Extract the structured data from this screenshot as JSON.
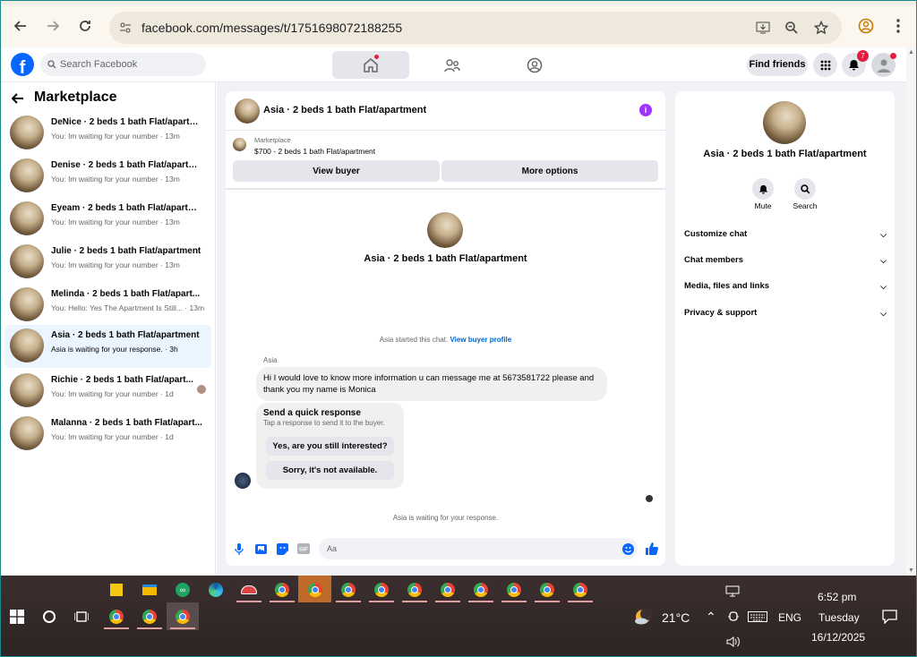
{
  "browser": {
    "url": "facebook.com/messages/t/1751698072188255",
    "icons": [
      "back-icon",
      "forward-icon",
      "reload-icon",
      "site-settings-icon",
      "install-icon",
      "zoom-icon",
      "bookmark-star-icon",
      "profile-icon",
      "menu-icon"
    ]
  },
  "fb": {
    "search_placeholder": "Search Facebook",
    "find_friends": "Find friends",
    "notif_count": "7"
  },
  "sidebar": {
    "title": "Marketplace",
    "conversations": [
      {
        "name": "DeNice · 2 beds 1 bath Flat/apartm...",
        "preview": "You: Im waiting for your number · 13m"
      },
      {
        "name": "Denise · 2 beds 1 bath Flat/apartm...",
        "preview": "You: Im waiting for your number · 13m"
      },
      {
        "name": "Eyeam · 2 beds 1 bath Flat/apartm...",
        "preview": "You: Im waiting for your number · 13m"
      },
      {
        "name": "Julie · 2 beds 1 bath Flat/apartment",
        "preview": "You: Im waiting for your number · 13m"
      },
      {
        "name": "Melinda · 2 beds 1 bath Flat/apart...",
        "preview": "You: Hello: Yes The Apartment Is Still... · 13m"
      },
      {
        "name": "Asia · 2 beds 1 bath Flat/apartment",
        "preview": "Asia is waiting for your response. · 3h"
      },
      {
        "name": "Richie · 2 beds 1 bath Flat/apart...",
        "preview": "You: Im waiting for your number · 1d"
      },
      {
        "name": "Malanna · 2 beds 1 bath Flat/apart...",
        "preview": "You: Im waiting for your number · 1d"
      }
    ]
  },
  "chat": {
    "title": "Asia · 2 beds 1 bath Flat/apartment",
    "marketplace_label": "Marketplace",
    "listing": "$700 - 2 beds 1 bath Flat/apartment",
    "view_buyer": "View buyer",
    "more_options": "More options",
    "center_name": "Asia · 2 beds 1 bath Flat/apartment",
    "started": "Asia started this chat.",
    "view_profile": "View buyer profile",
    "sender": "Asia",
    "message": "Hi I would love to know more information u can message me at 5673581722 please and thank you my name is Monica",
    "qr_title": "Send a quick response",
    "qr_sub": "Tap a response to send it to the buyer.",
    "qr_1": "Yes, are you still interested?",
    "qr_2": "Sorry, it's not available.",
    "waiting": "Asia is waiting for your response.",
    "input_placeholder": "Aa"
  },
  "right": {
    "name": "Asia · 2 beds 1 bath Flat/apartment",
    "mute": "Mute",
    "search": "Search",
    "rows": [
      "Customize chat",
      "Chat members",
      "Media, files and links",
      "Privacy & support"
    ]
  },
  "taskbar": {
    "temp": "21°C",
    "lang": "ENG",
    "time": "6:52 pm",
    "day": "Tuesday",
    "date": "16/12/2025"
  }
}
